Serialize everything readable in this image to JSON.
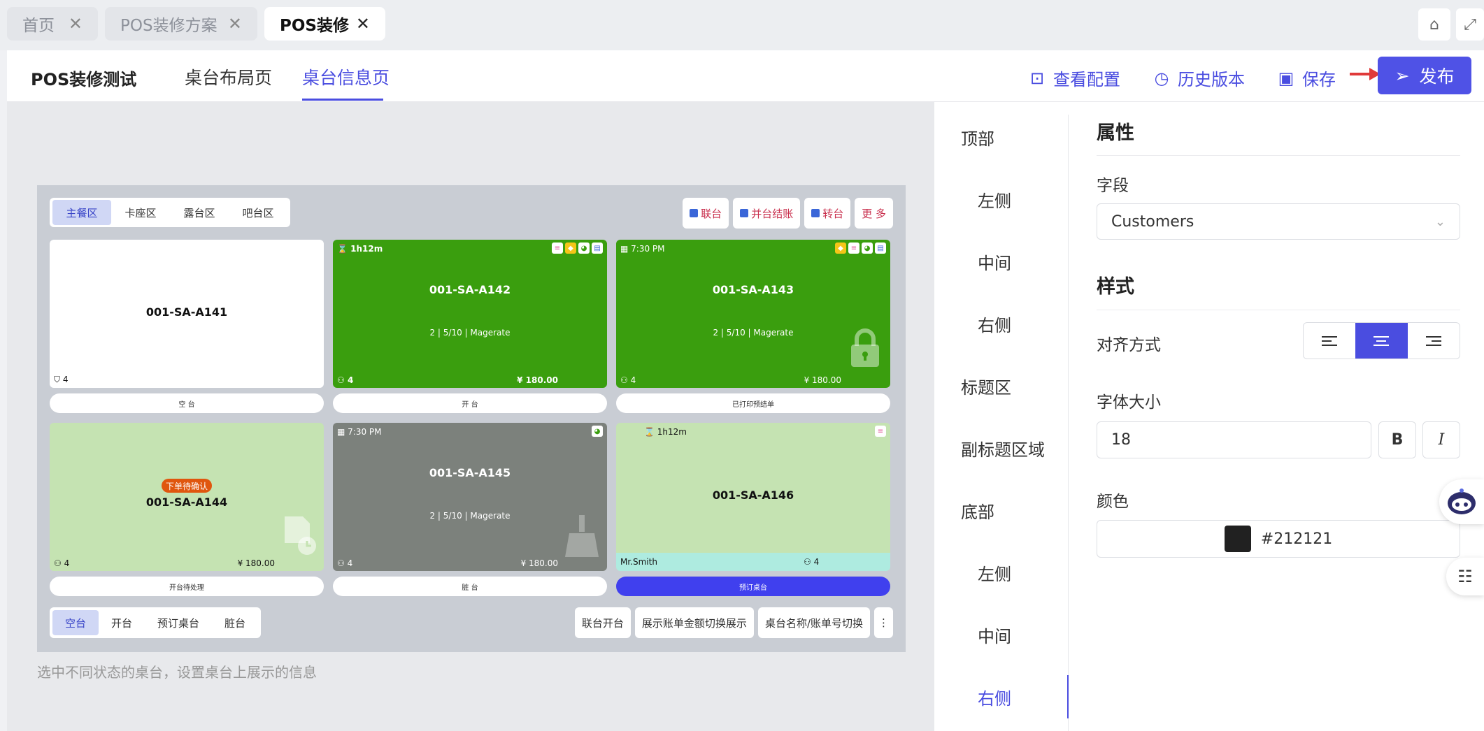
{
  "tabs": [
    {
      "label": "首页"
    },
    {
      "label": "POS装修方案"
    },
    {
      "label": "POS装修"
    }
  ],
  "header": {
    "title": "POS装修测试",
    "tabs": [
      {
        "label": "桌台布局页"
      },
      {
        "label": "桌台信息页"
      }
    ],
    "actions": {
      "config": "查看配置",
      "history": "历史版本",
      "save": "保存",
      "publish": "发布"
    }
  },
  "preview": {
    "zones": [
      "主餐区",
      "卡座区",
      "露台区",
      "吧台区"
    ],
    "actions": [
      "联台",
      "并台结账",
      "转台",
      "更 多"
    ],
    "cards": [
      {
        "name": "001-SA-A141",
        "seats": "4",
        "button": "空 台"
      },
      {
        "name": "001-SA-A142",
        "time": "1h12m",
        "info": "2 | 5/10 | Magerate",
        "seats": "4",
        "amount": "¥ 180.00",
        "button": "开 台"
      },
      {
        "name": "001-SA-A143",
        "time": "7:30 PM",
        "info": "2 | 5/10 | Magerate",
        "seats": "4",
        "amount": "¥ 180.00",
        "button": "已打印预结单"
      },
      {
        "name": "001-SA-A144",
        "tag": "下单待确认",
        "seats": "4",
        "amount": "¥ 180.00",
        "button": "开台待处理"
      },
      {
        "name": "001-SA-A145",
        "time": "7:30 PM",
        "info": "2 | 5/10 | Magerate",
        "seats": "4",
        "amount": "¥ 180.00",
        "button": "脏 台"
      },
      {
        "name": "001-SA-A146",
        "time": "1h12m",
        "customer": "Mr.Smith",
        "seats": "4",
        "button": "预订桌台"
      }
    ],
    "status_tabs": [
      "空台",
      "开台",
      "预订桌台",
      "脏台"
    ],
    "bottom_actions": [
      "联台开台",
      "展示账单金额切换展示",
      "桌台名称/账单号切换",
      "⋮"
    ],
    "hint": "选中不同状态的桌台，设置桌台上展示的信息"
  },
  "sidenav": {
    "items": [
      "顶部",
      "左侧",
      "中间",
      "右侧",
      "标题区",
      "副标题区域",
      "底部",
      "左侧",
      "中间",
      "右侧"
    ]
  },
  "panel": {
    "props_title": "属性",
    "field_label": "字段",
    "field_value": "Customers",
    "style_title": "样式",
    "align_label": "对齐方式",
    "font_size_label": "字体大小",
    "font_size_value": "18",
    "bold_label": "B",
    "italic_label": "I",
    "color_label": "颜色",
    "color_value": "#212121"
  },
  "colors": {
    "accent": "#4a4de0",
    "card_green": "#3a9e0e",
    "card_light_green": "#c5e3b2",
    "card_gray": "#7c817c",
    "reserve_bar": "#4040ee"
  }
}
